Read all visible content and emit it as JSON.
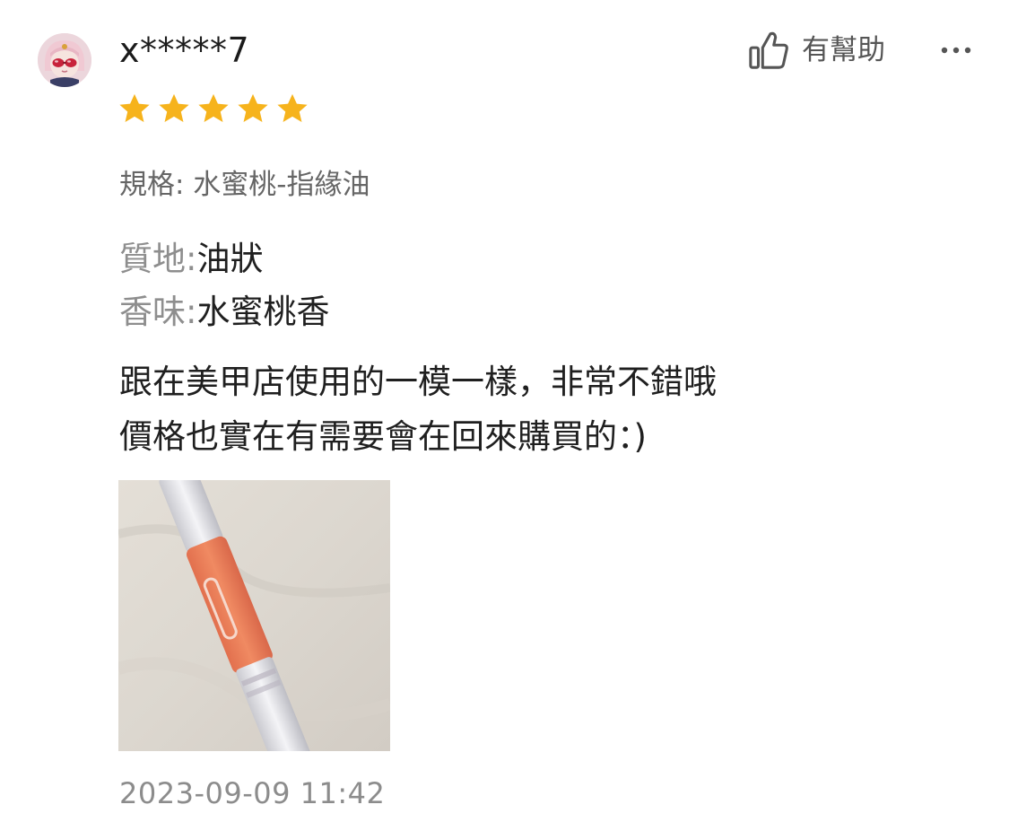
{
  "review": {
    "username": "x*****7",
    "rating": 5,
    "star_color": "#f6b31c",
    "spec": "規格: 水蜜桃-指緣油",
    "attributes": [
      {
        "key": "質地:",
        "value": "油狀"
      },
      {
        "key": "香味:",
        "value": "水蜜桃香"
      }
    ],
    "comment_lines": [
      "跟在美甲店使用的一模一樣，非常不錯哦",
      "價格也實在有需要會在回來購買的：)"
    ],
    "timestamp": "2023-09-09 11:42"
  },
  "actions": {
    "helpful_label": "有幫助",
    "helpful_icon": "thumbs-up-icon",
    "more_icon": "more-dots-icon"
  }
}
